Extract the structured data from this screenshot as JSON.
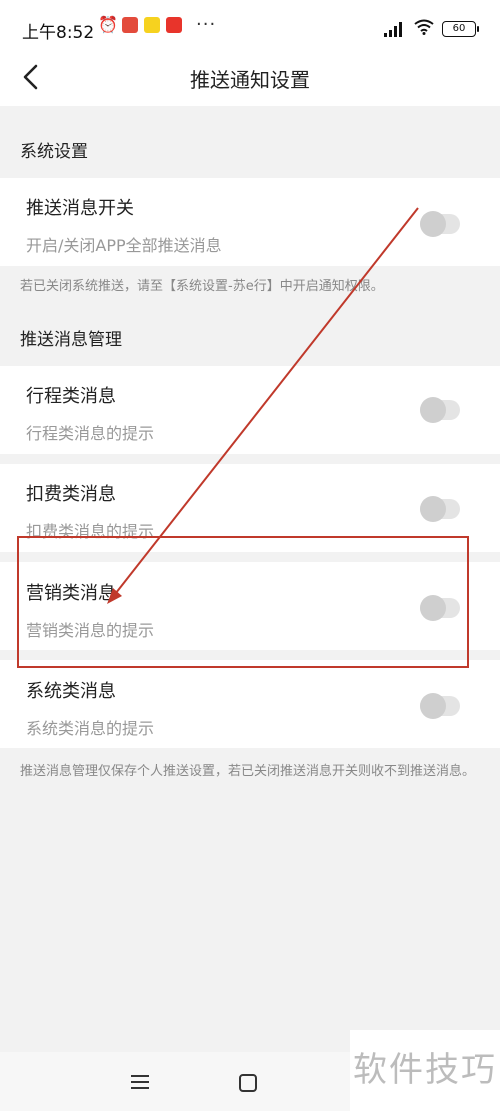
{
  "status_bar": {
    "time": "上午8:52",
    "dots": "···",
    "battery": "60"
  },
  "header": {
    "title": "推送通知设置"
  },
  "system_section": {
    "header": "系统设置",
    "push_switch": {
      "title": "推送消息开关",
      "subtitle": "开启/关闭APP全部推送消息",
      "enabled": false
    },
    "note": "若已关闭系统推送，请至【系统设置-苏e行】中开启通知权限。"
  },
  "manage_section": {
    "header": "推送消息管理",
    "items": [
      {
        "title": "行程类消息",
        "subtitle": "行程类消息的提示",
        "enabled": false
      },
      {
        "title": "扣费类消息",
        "subtitle": "扣费类消息的提示",
        "enabled": false
      },
      {
        "title": "营销类消息",
        "subtitle": "营销类消息的提示",
        "enabled": false
      },
      {
        "title": "系统类消息",
        "subtitle": "系统类消息的提示",
        "enabled": false
      }
    ],
    "note": "推送消息管理仅保存个人推送设置，若已关闭推送消息开关则收不到推送消息。"
  },
  "colors": {
    "annotation": "#c0392b",
    "background": "#f2f2f2",
    "card": "#ffffff"
  },
  "watermark": "软件技巧"
}
